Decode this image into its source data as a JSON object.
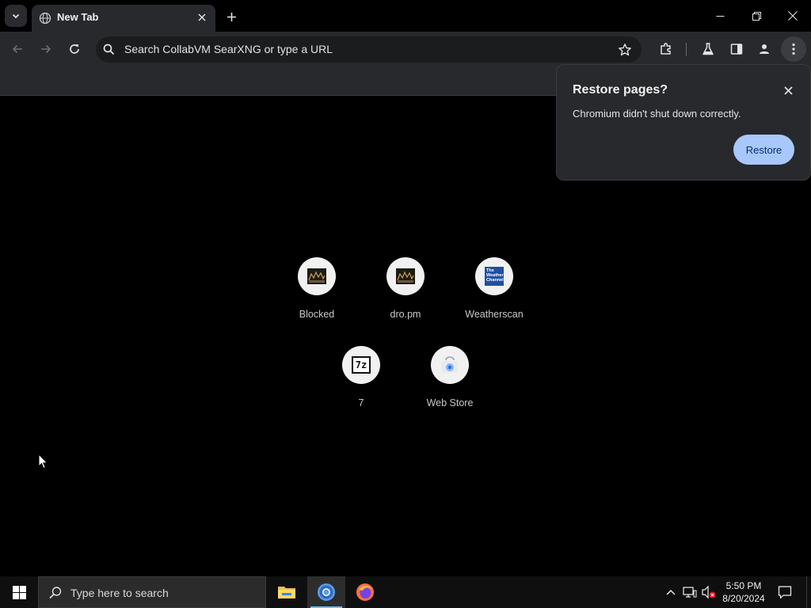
{
  "browser": {
    "tab": {
      "title": "New Tab"
    },
    "omnibox": {
      "placeholder": "Search CollabVM SearXNG or type a URL"
    }
  },
  "restore_popup": {
    "title": "Restore pages?",
    "message": "Chromium didn't shut down correctly.",
    "button_label": "Restore"
  },
  "shortcuts": [
    {
      "label": "Blocked",
      "icon": "dropm-icon"
    },
    {
      "label": "dro.pm",
      "icon": "dropm-icon"
    },
    {
      "label": "Weatherscan",
      "icon": "weather-channel-icon",
      "icon_text": "The Weather Channel"
    },
    {
      "label": "7",
      "icon": "7zip-icon",
      "icon_text": "7z"
    },
    {
      "label": "Web Store",
      "icon": "chrome-web-store-icon"
    }
  ],
  "taskbar": {
    "search_placeholder": "Type here to search",
    "time": "5:50 PM",
    "date": "8/20/2024",
    "apps": [
      "file-explorer-icon",
      "chromium-icon",
      "firefox-icon"
    ]
  },
  "colors": {
    "accent_button": "#a8c7fa",
    "toolbar_bg": "#28292c",
    "content_bg": "#000000",
    "taskbar_bg": "#0f0f0f"
  }
}
